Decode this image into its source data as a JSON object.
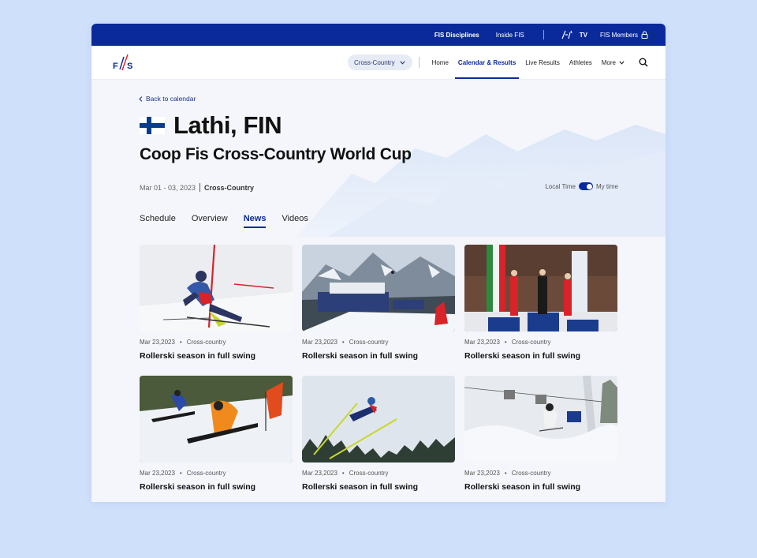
{
  "topbar": {
    "links": [
      "FIS Disciplines",
      "Inside FIS"
    ],
    "tv_label": "TV",
    "members_label": "FIS Members",
    "members_icon": "lock-icon"
  },
  "nav": {
    "logo_text": "FIS",
    "discipline_select": "Cross-Country",
    "items": [
      "Home",
      "Calendar & Results",
      "Live Results",
      "Athletes",
      "More"
    ],
    "active_index": 1,
    "search_icon": "search-icon"
  },
  "event": {
    "back_label": "Back to calendar",
    "location": "Lathi, FIN",
    "name": "Coop Fis Cross-Country World Cup",
    "dates": "Mar 01 - 03, 2023",
    "discipline": "Cross-Country",
    "time_toggle": {
      "left": "Local Time",
      "right": "My time"
    },
    "flag": "finland-flag",
    "colors": {
      "brand": "#0a2a9c"
    }
  },
  "tabs": [
    "Schedule",
    "Overview",
    "News",
    "Videos"
  ],
  "active_tab": 2,
  "news": [
    {
      "date": "Mar 23,2023",
      "category": "Cross-country",
      "title": "Rollerski season in full swing",
      "image": "slalom-skier"
    },
    {
      "date": "Mar 23,2023",
      "category": "Cross-country",
      "title": "Rollerski season in full swing",
      "image": "mountain-venue"
    },
    {
      "date": "Mar 23,2023",
      "category": "Cross-country",
      "title": "Rollerski season in full swing",
      "image": "podium-ceremony"
    },
    {
      "date": "Mar 23,2023",
      "category": "Cross-country",
      "title": "Rollerski season in full swing",
      "image": "snowboard-cross"
    },
    {
      "date": "Mar 23,2023",
      "category": "Cross-country",
      "title": "Rollerski season in full swing",
      "image": "ski-jumper"
    },
    {
      "date": "Mar 23,2023",
      "category": "Cross-country",
      "title": "Rollerski season in full swing",
      "image": "moguls-skier"
    }
  ]
}
